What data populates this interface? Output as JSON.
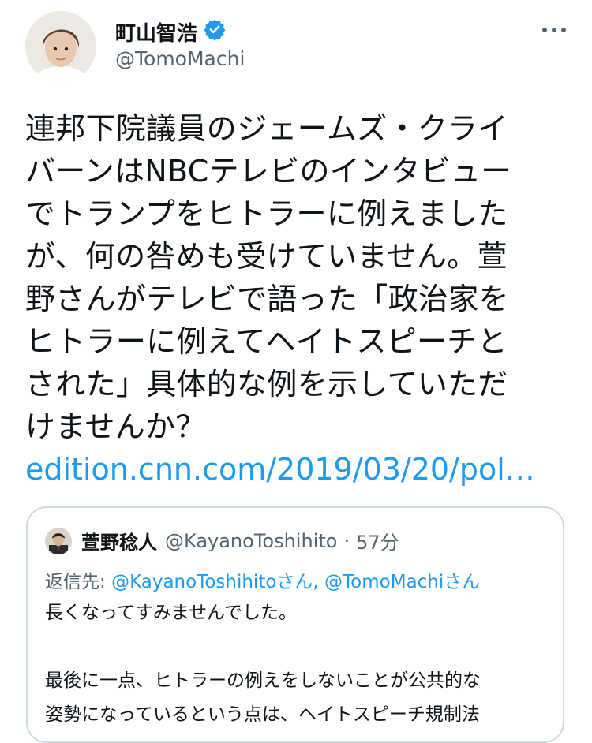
{
  "author": {
    "name": "町山智浩",
    "handle": "@TomoMachi",
    "verified": true
  },
  "tweet": {
    "text": "連邦下院議員のジェームズ・クライ\nバーンはNBCテレビのインタビュー\nでトランプをヒトラーに例えました\nが、何の咎めも受けていません。萱\n野さんがテレビで語った「政治家を\nヒトラーに例えてヘイトスピーチと\nされた」具体的な例を示していただ\nけませんか？",
    "link": "edition.cnn.com/2019/03/20/pol…"
  },
  "quoted": {
    "name": "萱野稔人",
    "handle": "@KayanoToshihito",
    "separator": "·",
    "time": "57分",
    "reply_prefix": "返信先:",
    "reply_mentions": "@KayanoToshihitoさん, @TomoMachiさん",
    "body": "長くなってすみませんでした。\n\n最後に一点、ヒトラーの例えをしないことが公共的な\n姿勢になっているという点は、ヘイトスピーチ規制法"
  },
  "icons": {
    "verified": "verified-badge-icon",
    "more": "more-options-icon"
  },
  "colors": {
    "link": "#1d9bf0",
    "secondary_text": "#536471",
    "border": "#cfd9de"
  }
}
